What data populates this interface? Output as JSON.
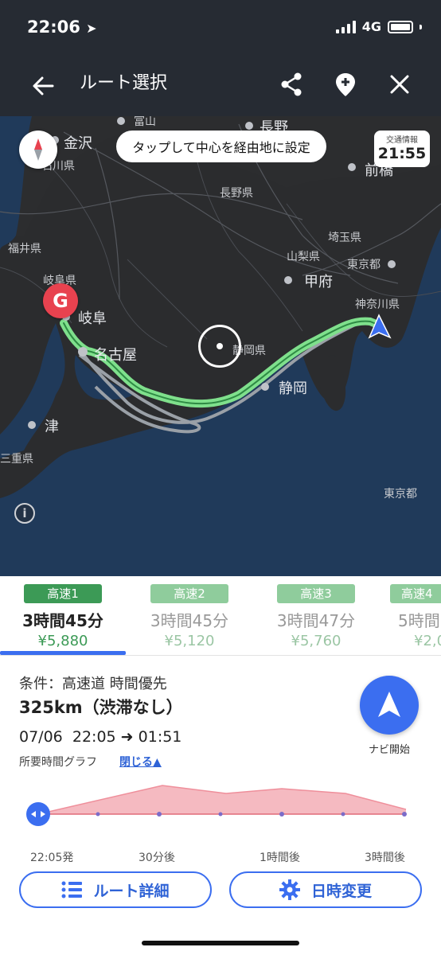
{
  "status": {
    "time": "22:06",
    "network": "4G"
  },
  "header": {
    "title": "ルート選択"
  },
  "map": {
    "tip": "タップして中心を経由地に設定",
    "traffic_label": "交通情報",
    "traffic_time": "21:55",
    "goal_marker": "G",
    "info_icon": "i",
    "labels": {
      "toyama": "富山",
      "nagano_city": "長野",
      "kanazawa": "金沢",
      "ishikawa": "石川県",
      "maebashi": "前橋",
      "nagano_pref": "長野県",
      "fukui": "福井県",
      "saitama": "埼玉県",
      "yamanashi": "山梨県",
      "tokyo": "東京都",
      "kofu": "甲府",
      "gifu_pref": "岐阜県",
      "gifu": "岐阜",
      "kanagawa": "神奈川県",
      "nagoya": "名古屋",
      "shizuoka_pref": "静岡県",
      "shizuoka": "静岡",
      "tsu": "津",
      "mie": "三重県",
      "tokyo_sea": "東京都"
    }
  },
  "routes": [
    {
      "badge": "高速1",
      "time": "3時間45分",
      "fare": "¥5,880",
      "active": true
    },
    {
      "badge": "高速2",
      "time": "3時間45分",
      "fare": "¥5,120",
      "active": false
    },
    {
      "badge": "高速3",
      "time": "3時間47分",
      "fare": "¥5,760",
      "active": false
    },
    {
      "badge": "高速4",
      "time": "5時間",
      "fare": "¥2,0",
      "active": false
    }
  ],
  "details": {
    "condition": "条件：高速道 時間優先",
    "distance": "325km（渋滞なし）",
    "date": "07/06",
    "depart": "22:05",
    "arrow": "➜",
    "arrive": "01:51",
    "graph_label": "所要時間グラフ",
    "graph_toggle": "閉じる▲",
    "nav_start": "ナビ開始",
    "axis": [
      "22:05発",
      "30分後",
      "1時間後",
      "3時間後"
    ],
    "route_detail_button": "ルート詳細",
    "datetime_button": "日時変更"
  },
  "colors": {
    "accent": "#3b6ef0",
    "route_green": "#3c9a56",
    "route_line": "#7fe08c",
    "graph_fill": "#f3aeb6",
    "goal": "#e8424f"
  }
}
